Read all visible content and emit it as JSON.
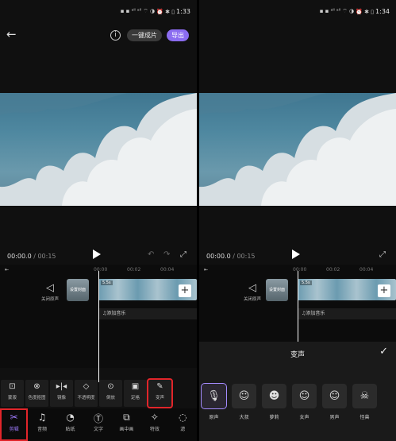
{
  "status_bar": {
    "left_icons": "▪ ▪ ᵃˡˡ ᵃˡˡ ⌔ ◑",
    "right_icons": "⏰ ✱ ▯",
    "time_left": "1:33",
    "time_right": "1:34"
  },
  "header": {
    "info_glyph": "i",
    "onekey_label": "一键成片",
    "export_label": "导出"
  },
  "player": {
    "current_time": "00:00.0",
    "separator": " / ",
    "total_time": "00:15"
  },
  "timeline": {
    "ruler_ticks": [
      "00:00",
      "00:02",
      "00:04"
    ],
    "audio_toggle_label": "关闭原声",
    "cover_label": "设置封面",
    "clip_duration": "5.5s",
    "add_music_label": "♫添加音乐"
  },
  "tools": [
    {
      "icon": "⊡",
      "label": "蒙版"
    },
    {
      "icon": "⊗",
      "label": "色度抠图"
    },
    {
      "icon": "▸|◂",
      "label": "镜像"
    },
    {
      "icon": "◇",
      "label": "不透明度"
    },
    {
      "icon": "⊙",
      "label": "倒放"
    },
    {
      "icon": "▣",
      "label": "定格"
    },
    {
      "icon": "✎",
      "label": "变声"
    }
  ],
  "tabs": [
    {
      "icon": "✂",
      "label": "剪辑"
    },
    {
      "icon": "♫",
      "label": "音频"
    },
    {
      "icon": "◔",
      "label": "贴纸"
    },
    {
      "icon": "Ⓣ",
      "label": "文字"
    },
    {
      "icon": "⧉",
      "label": "画中画"
    },
    {
      "icon": "✧",
      "label": "特效"
    },
    {
      "icon": "◌",
      "label": "滤"
    }
  ],
  "voice_sheet": {
    "title": "变声",
    "confirm_icon": "✓",
    "options": [
      {
        "icon": "🎙",
        "label": "原声"
      },
      {
        "icon": "☺",
        "label": "大叔"
      },
      {
        "icon": "☻",
        "label": "萝莉"
      },
      {
        "icon": "☺",
        "label": "女声"
      },
      {
        "icon": "☺",
        "label": "男声"
      },
      {
        "icon": "☠",
        "label": "怪兽"
      }
    ]
  },
  "colors": {
    "accent": "#8b6cf0",
    "highlight": "#e1252a",
    "background": "#101010"
  }
}
